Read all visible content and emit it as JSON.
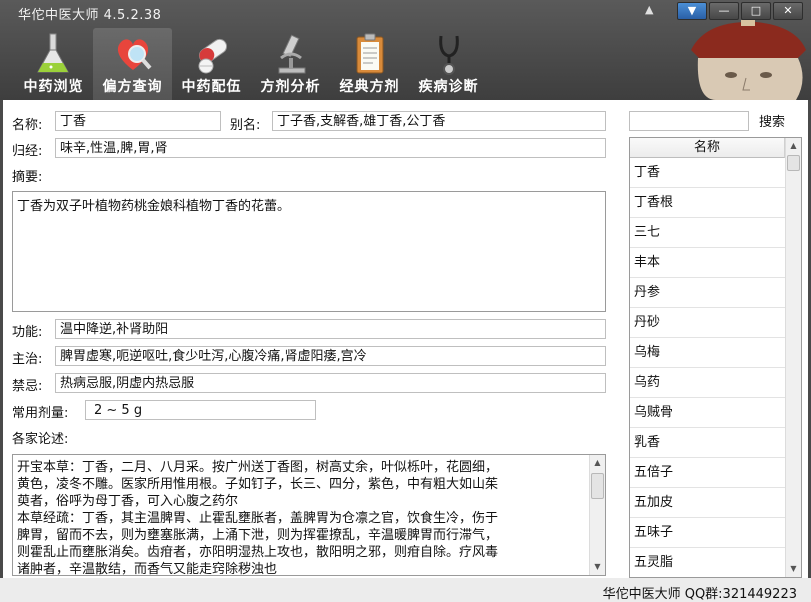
{
  "window": {
    "title": "华佗中医大师  4.5.2.38"
  },
  "toolbar": {
    "tabs": [
      {
        "label": "中药浏览",
        "icon": "flask-icon"
      },
      {
        "label": "偏方查询",
        "icon": "heart-magnifier-icon"
      },
      {
        "label": "中药配伍",
        "icon": "pills-icon"
      },
      {
        "label": "方剂分析",
        "icon": "microscope-icon"
      },
      {
        "label": "经典方剂",
        "icon": "clipboard-icon"
      },
      {
        "label": "疾病诊断",
        "icon": "stethoscope-icon"
      }
    ],
    "active_index": 1
  },
  "form": {
    "name_label": "名称:",
    "name_value": "丁香",
    "alias_label": "别名:",
    "alias_value": "丁子香,支解香,雄丁香,公丁香",
    "meridian_label": "归经:",
    "meridian_value": "味辛,性温,脾,胃,肾",
    "summary_label": "摘要:",
    "summary_value": "丁香为双子叶植物药桃金娘科植物丁香的花蕾。",
    "function_label": "功能:",
    "function_value": "温中降逆,补肾助阳",
    "indication_label": "主治:",
    "indication_value": "脾胃虚寒,呃逆呕吐,食少吐泻,心腹冷痛,肾虚阳痿,宫冷",
    "contra_label": "禁忌:",
    "contra_value": "热病忌服,阴虚内热忌服",
    "dosage_label": "常用剂量:",
    "dosage_value": "2 ~ 5 g",
    "commentary_label": "各家论述:",
    "commentary_lines": [
      "开宝本草：丁香，二月、八月采。按广州送丁香图，树高丈余，叶似栎叶，花圆细，",
      "黄色，凌冬不雕。医家所用惟用根。子如钉子，长三、四分，紫色，中有粗大如山茱",
      "萸者，俗呼为母丁香，可入心腹之药尔",
      "本草经疏：丁香，其主温脾胃、止霍乱壅胀者，盖脾胃为仓凛之官，饮食生冷，伤于",
      "脾胃，留而不去，则为壅塞胀满，上涌下泄，则为挥霍撩乱，辛温暖脾胃而行滞气，",
      "则霍乱止而壅胀消矣。齿疳者，亦阳明湿热上攻也，散阳明之邪，则疳自除。疗风毒",
      "诸肿者，辛温散结，而香气又能走窍除秽浊也"
    ]
  },
  "search": {
    "button_label": "搜索",
    "value": ""
  },
  "herb_list": {
    "header": "名称",
    "items": [
      "丁香",
      "丁香根",
      "三七",
      "丰本",
      "丹参",
      "丹砂",
      "乌梅",
      "乌药",
      "乌贼骨",
      "乳香",
      "五倍子",
      "五加皮",
      "五味子",
      "五灵脂"
    ]
  },
  "status_bar": {
    "text": "华佗中医大师  QQ群:321449223"
  }
}
